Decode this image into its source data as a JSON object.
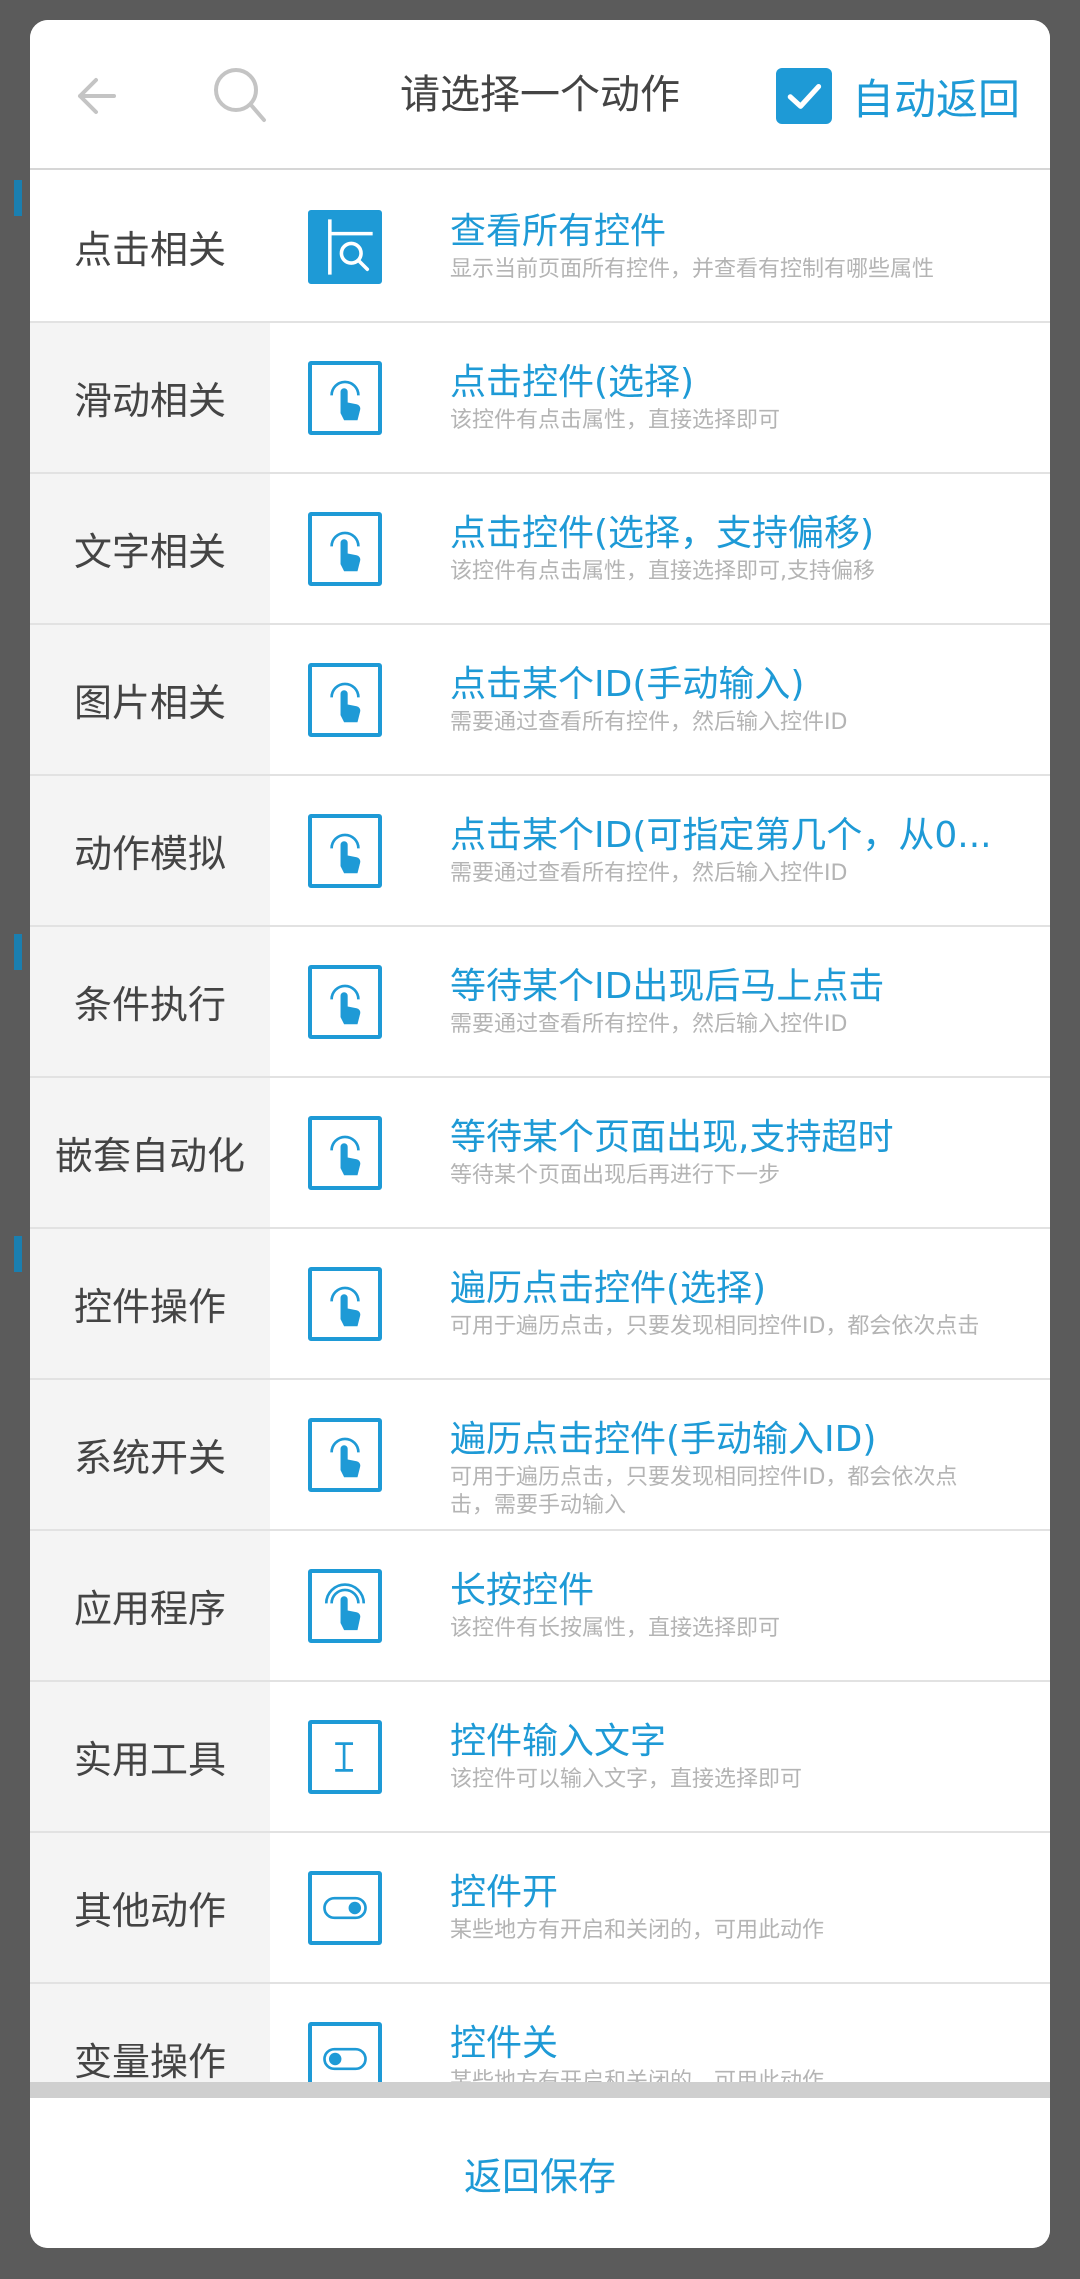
{
  "header": {
    "title": "请选择一个动作",
    "auto_return_label": "自动返回",
    "auto_return_checked": true
  },
  "categories": [
    {
      "label": "点击相关",
      "active": true
    },
    {
      "label": "滑动相关",
      "active": false
    },
    {
      "label": "文字相关",
      "active": false
    },
    {
      "label": "图片相关",
      "active": false
    },
    {
      "label": "动作模拟",
      "active": false
    },
    {
      "label": "条件执行",
      "active": false
    },
    {
      "label": "嵌套自动化",
      "active": false
    },
    {
      "label": "控件操作",
      "active": false
    },
    {
      "label": "系统开关",
      "active": false
    },
    {
      "label": "应用程序",
      "active": false
    },
    {
      "label": "实用工具",
      "active": false
    },
    {
      "label": "其他动作",
      "active": false
    },
    {
      "label": "变量操作",
      "active": false
    }
  ],
  "actions": [
    {
      "icon": "inspect-controls-icon",
      "title": "查看所有控件",
      "desc": "显示当前页面所有控件，并查看有控制有哪些属性"
    },
    {
      "icon": "tap-icon",
      "title": "点击控件(选择)",
      "desc": "该控件有点击属性，直接选择即可"
    },
    {
      "icon": "tap-icon",
      "title": "点击控件(选择，支持偏移)",
      "desc": "该控件有点击属性，直接选择即可,支持偏移"
    },
    {
      "icon": "tap-icon",
      "title": "点击某个ID(手动输入)",
      "desc": "需要通过查看所有控件，然后输入控件ID"
    },
    {
      "icon": "tap-icon",
      "title": "点击某个ID(可指定第几个，从0...",
      "desc": "需要通过查看所有控件，然后输入控件ID"
    },
    {
      "icon": "tap-icon",
      "title": "等待某个ID出现后马上点击",
      "desc": "需要通过查看所有控件，然后输入控件ID"
    },
    {
      "icon": "tap-icon",
      "title": "等待某个页面出现,支持超时",
      "desc": "等待某个页面出现后再进行下一步"
    },
    {
      "icon": "tap-icon",
      "title": "遍历点击控件(选择)",
      "desc": "可用于遍历点击，只要发现相同控件ID，都会依次点击"
    },
    {
      "icon": "tap-icon",
      "title": "遍历点击控件(手动输入ID)",
      "desc": "可用于遍历点击，只要发现相同控件ID，都会依次点击，需要手动输入"
    },
    {
      "icon": "long-press-icon",
      "title": "长按控件",
      "desc": "该控件有长按属性，直接选择即可"
    },
    {
      "icon": "text-input-icon",
      "title": "控件输入文字",
      "desc": "该控件可以输入文字，直接选择即可"
    },
    {
      "icon": "toggle-on-icon",
      "title": "控件开",
      "desc": "某些地方有开启和关闭的，可用此动作"
    },
    {
      "icon": "toggle-off-icon",
      "title": "控件关",
      "desc": "某些地方有开启和关闭的，可用此动作"
    }
  ],
  "footer": {
    "save_label": "返回保存"
  },
  "colors": {
    "accent": "#1e9ad6",
    "overlay": "#5b5b5b"
  }
}
